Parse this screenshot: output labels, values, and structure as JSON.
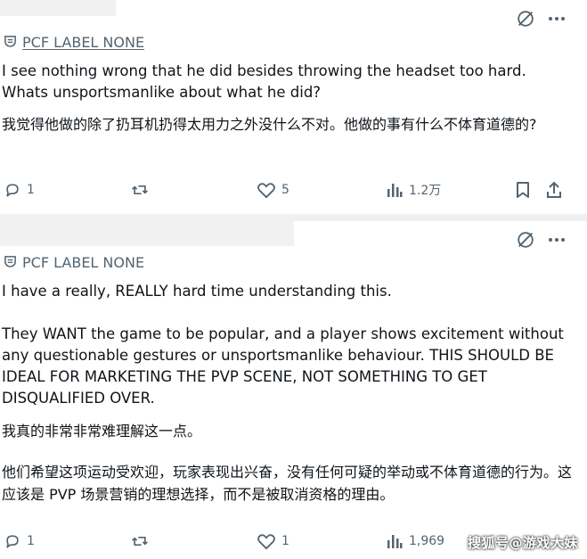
{
  "post1": {
    "label": "PCF LABEL NONE",
    "text_en": "I see nothing wrong that he did besides throwing the headset too hard.\nWhats unsportsmanlike about what he did?",
    "text_zh": "我觉得他做的除了扔耳机扔得太用力之外没什么不对。他做的事有什么不体育道德的?",
    "replies": "1",
    "likes": "5",
    "views": "1.2万"
  },
  "post2": {
    "label": "PCF LABEL NONE",
    "text_en1": "I have a really, REALLY hard time understanding this.",
    "text_en2": "They WANT the game to be popular, and a player shows excitement without any questionable gestures or unsportsmanlike behaviour. THIS SHOULD BE IDEAL FOR MARKETING THE PVP SCENE, NOT SOMETHING TO GET DISQUALIFIED OVER.",
    "text_zh1": "我真的非常非常难理解这一点。",
    "text_zh2": "他们希望这项运动受欢迎，玩家表现出兴奋，没有任何可疑的举动或不体育道德的行为。这应该是 PVP 场景营销的理想选择，而不是被取消资格的理由。",
    "replies": "1",
    "likes": "1",
    "views": "1,969"
  },
  "watermark": "搜狐号@游戏大妹",
  "icons": {
    "grok": "grok-icon",
    "more": "more-icon",
    "label": "label-icon",
    "reply": "reply-icon",
    "repost": "repost-icon",
    "like": "like-icon",
    "views": "views-icon",
    "bookmark": "bookmark-icon",
    "share": "share-icon"
  },
  "colors": {
    "text": "#0f1419",
    "muted": "#536471",
    "divider": "#eef0f2"
  }
}
